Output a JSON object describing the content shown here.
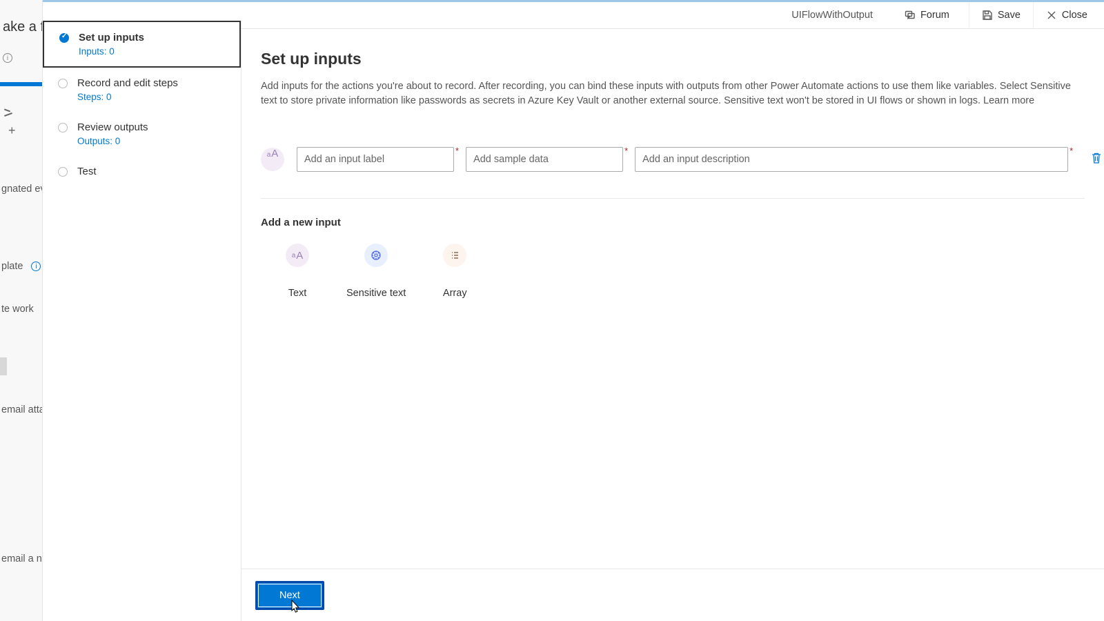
{
  "background": {
    "title_fragment": "ake a fl…",
    "item_gnated": "gnated even",
    "item_plate": "plate",
    "item_work": "te work",
    "item_attach": "email attac",
    "item_email_note": "email a n…"
  },
  "topbar": {
    "flow_name": "UIFlowWithOutput",
    "forum": "Forum",
    "save": "Save",
    "close": "Close"
  },
  "steps": {
    "s1_title": "Set up inputs",
    "s1_sub": "Inputs: 0",
    "s2_title": "Record and edit steps",
    "s2_sub": "Steps: 0",
    "s3_title": "Review outputs",
    "s3_sub": "Outputs: 0",
    "s4_title": "Test"
  },
  "main": {
    "title": "Set up inputs",
    "description": "Add inputs for the actions you're about to record. After recording, you can bind these inputs with outputs from other Power Automate actions to use them like variables. Select Sensitive text to store private information like passwords as secrets in Azure Key Vault or another external source. Sensitive text won't be stored in UI flows or shown in logs. ",
    "learn_more": "Learn more",
    "input_label_ph": "Add an input label",
    "input_sample_ph": "Add sample data",
    "input_desc_ph": "Add an input description",
    "add_new_title": "Add a new input",
    "type_text": "Text",
    "type_sensitive": "Sensitive text",
    "type_array": "Array"
  },
  "footer": {
    "next": "Next"
  }
}
